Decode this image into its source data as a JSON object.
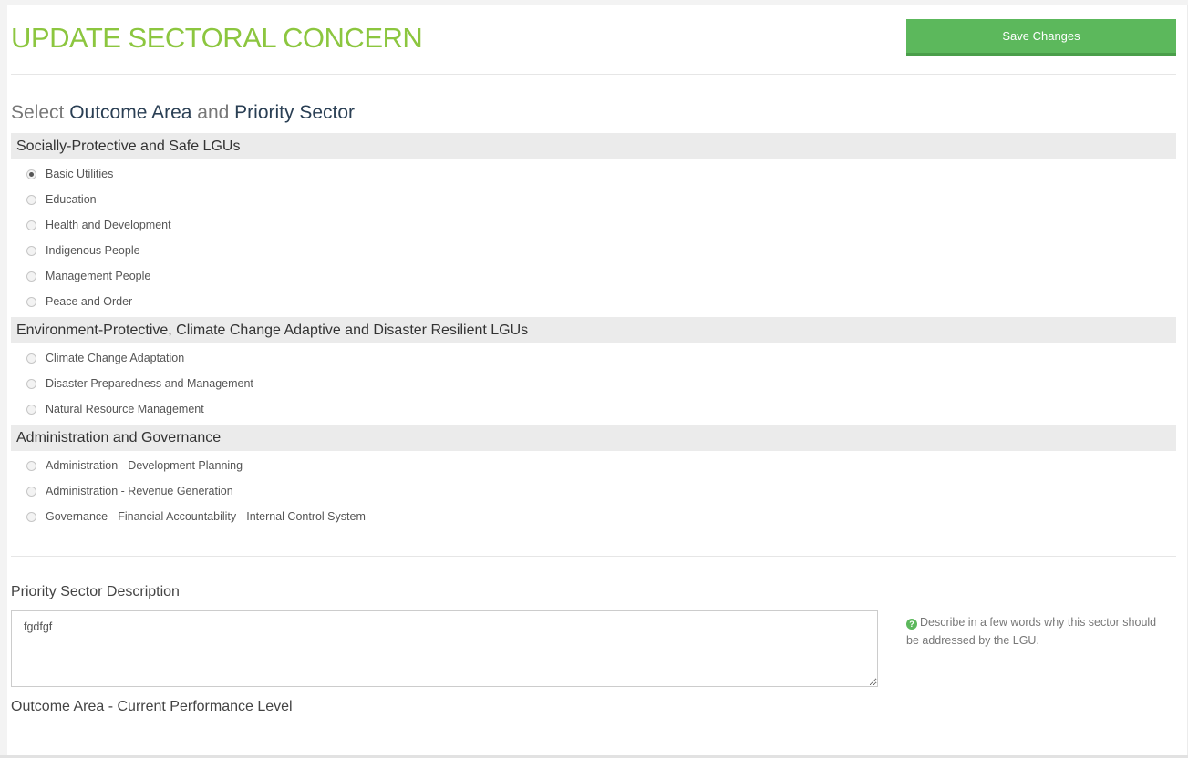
{
  "header": {
    "title": "UPDATE SECTORAL CONCERN",
    "save_label": "Save Changes"
  },
  "section": {
    "prefix": "Select ",
    "outcome": "Outcome Area",
    "and": " and ",
    "priority": "Priority Sector"
  },
  "groups": [
    {
      "title": "Socially-Protective and Safe LGUs",
      "options": [
        "Basic Utilities",
        "Education",
        "Health and Development",
        "Indigenous People",
        "Management People",
        "Peace and Order"
      ]
    },
    {
      "title": "Environment-Protective, Climate Change Adaptive and Disaster Resilient LGUs",
      "options": [
        "Climate Change Adaptation",
        "Disaster Preparedness and Management",
        "Natural Resource Management"
      ]
    },
    {
      "title": "Administration and Governance",
      "options": [
        "Administration - Development Planning",
        "Administration - Revenue Generation",
        "Governance - Financial Accountability - Internal Control System"
      ]
    }
  ],
  "selected_option": "Basic Utilities",
  "description": {
    "label": "Priority Sector Description",
    "value": "fgdfgf",
    "help_icon": "question-circle-icon",
    "help_text": "Describe in a few words why this sector should be addressed by the LGU."
  },
  "next_field": {
    "label": "Outcome Area - Current Performance Level"
  },
  "colors": {
    "title": "#8cc63f",
    "button": "#5cb85c",
    "heading_emphasis": "#2a3f54",
    "group_header_bg": "#ebebeb"
  }
}
